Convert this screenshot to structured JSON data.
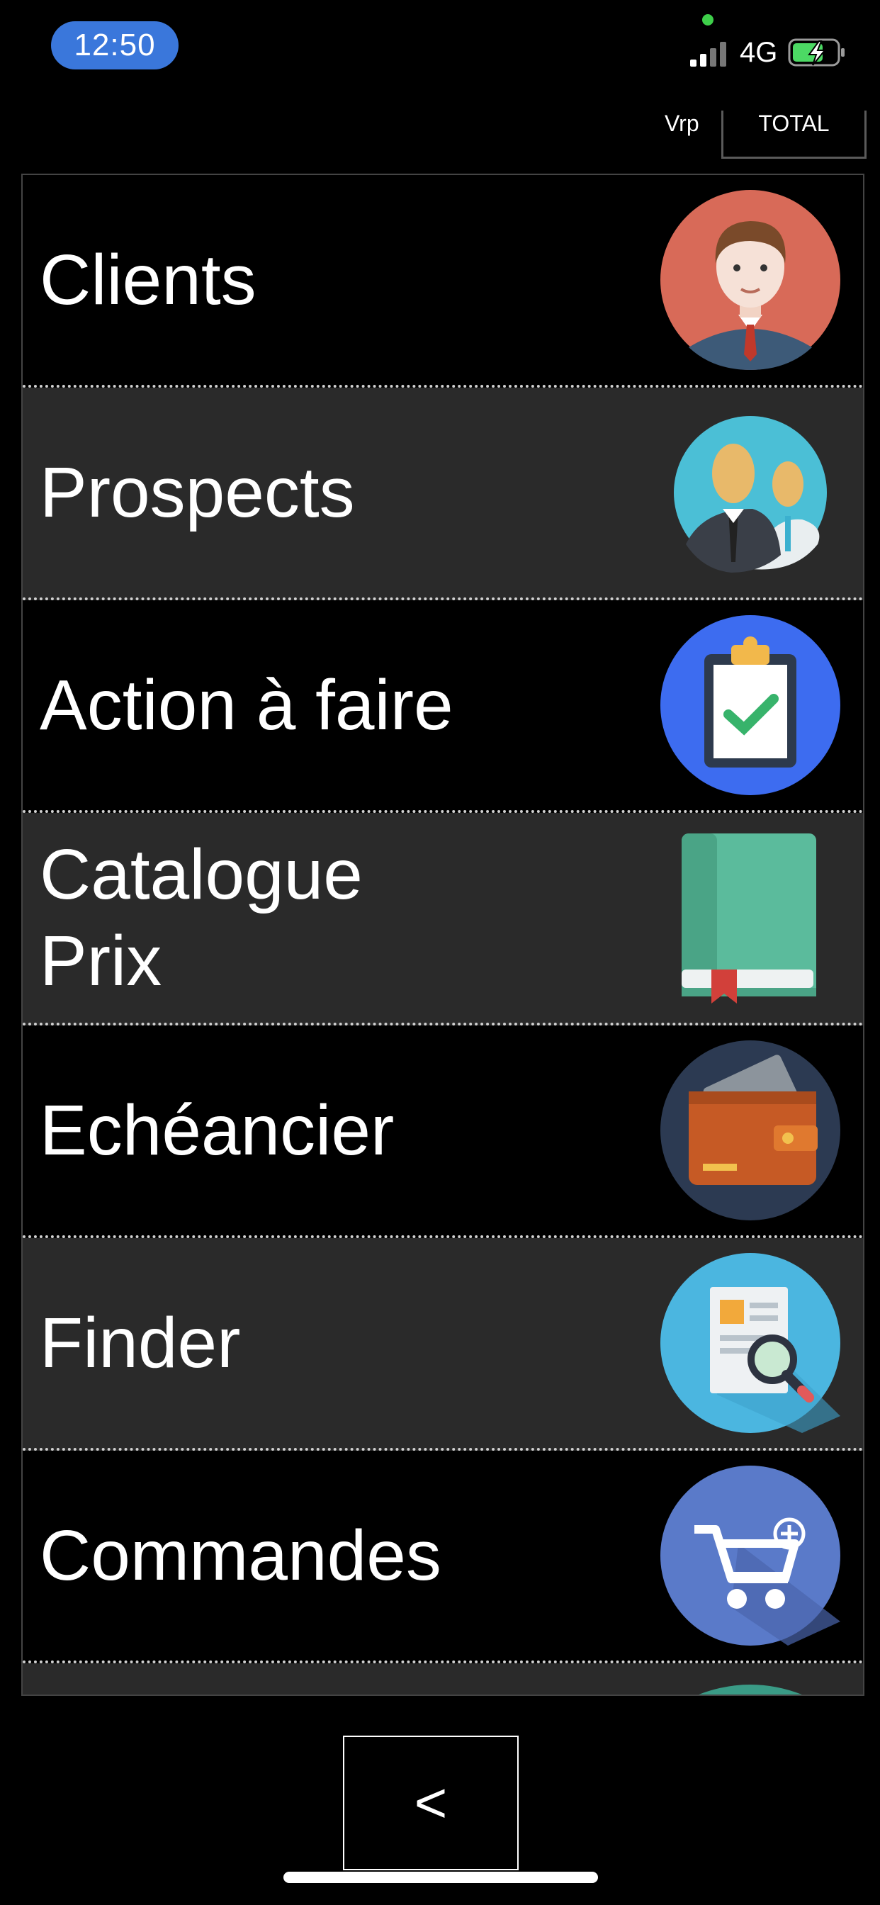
{
  "status_bar": {
    "time": "12:50",
    "network": "4G",
    "icons": [
      "signal-icon",
      "battery-charging-icon"
    ]
  },
  "tabs": [
    {
      "label": "Vrp"
    },
    {
      "label": "TOTAL",
      "selected": true
    }
  ],
  "menu": {
    "items": [
      {
        "label": "Clients",
        "icon": "client-avatar-icon"
      },
      {
        "label": "Prospects",
        "icon": "prospects-people-icon"
      },
      {
        "label": "Action à faire",
        "icon": "clipboard-check-icon"
      },
      {
        "label": "Catalogue\nPrix",
        "icon": "book-icon"
      },
      {
        "label": "Echéancier",
        "icon": "wallet-icon"
      },
      {
        "label": "Finder",
        "icon": "document-search-icon"
      },
      {
        "label": "Commandes",
        "icon": "cart-add-icon"
      }
    ]
  },
  "footer": {
    "back_label": "<"
  },
  "colors": {
    "background": "#000000",
    "row_alt": "#2a2a2a",
    "time_pill": "#3a77db"
  }
}
